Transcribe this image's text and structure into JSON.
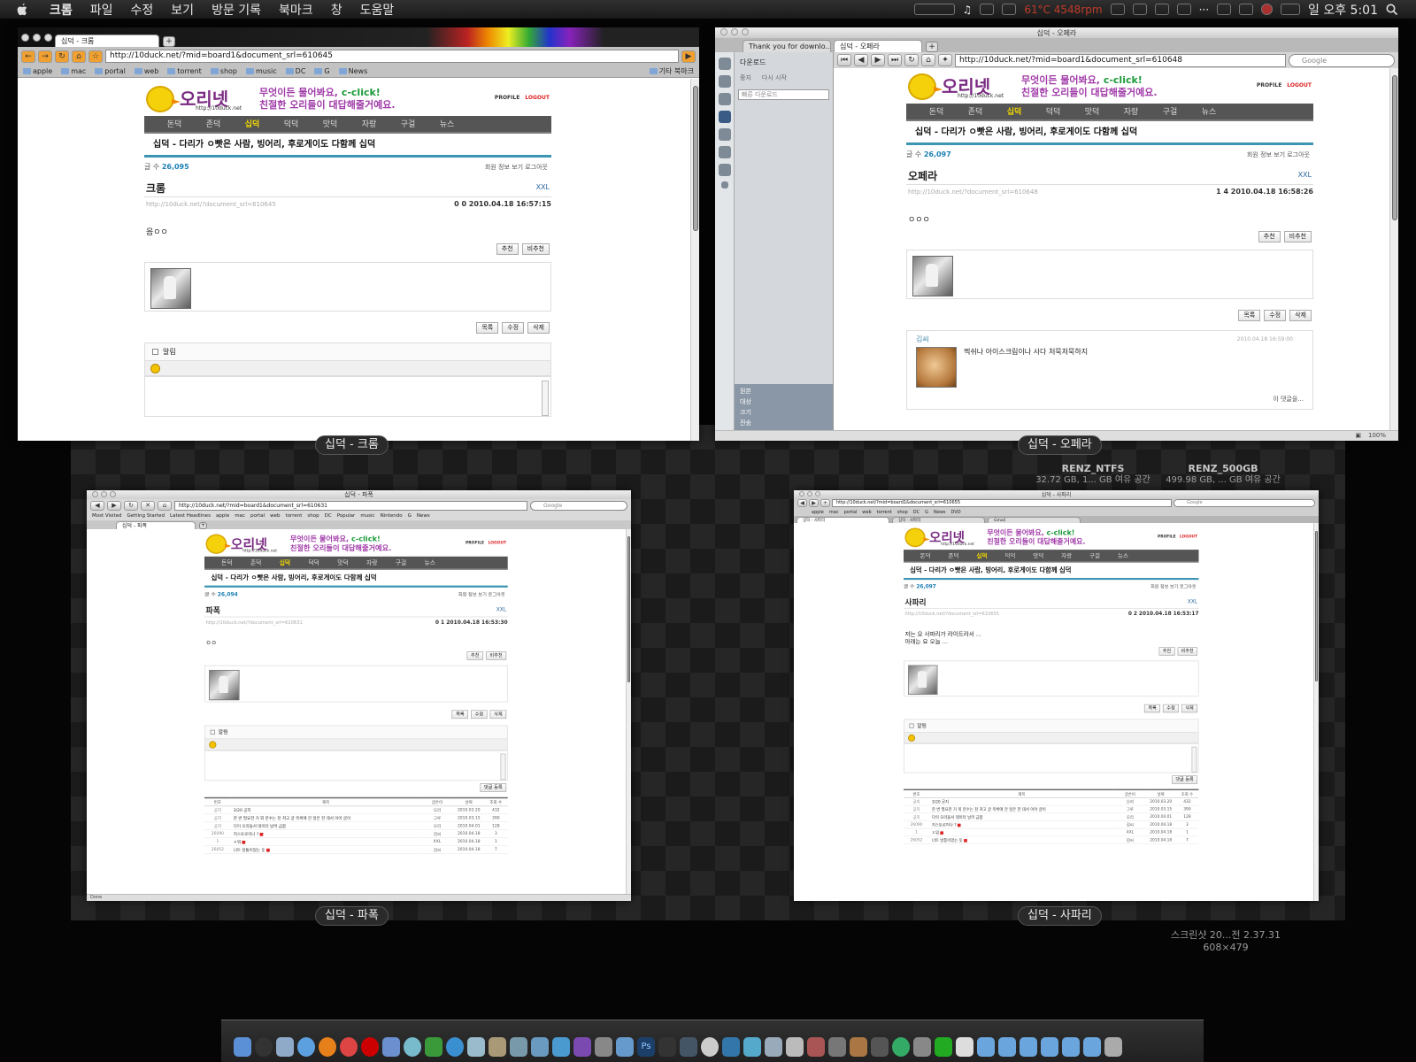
{
  "menubar": {
    "items": [
      "크롬",
      "파일",
      "수정",
      "보기",
      "방문 기록",
      "북마크",
      "창",
      "도움말"
    ],
    "temperature": "61°C 4548rpm",
    "clock": "일 오후 5:01"
  },
  "drives": [
    {
      "name": "RENZ_NTFS",
      "info": "32.72 GB, 1... GB 여유 공간"
    },
    {
      "name": "RENZ_500GB",
      "info": "499.98 GB, ... GB 여유 공간"
    }
  ],
  "screenshot_file": {
    "name": "스크린샷 20...전 2.37.31",
    "dims": "608×479"
  },
  "site": {
    "logo": "오리넷",
    "logo_sub": "http://10duck.net",
    "slogan1": "무엇이든 물어봐요, ",
    "slogan_click": "c-click!",
    "slogan2": "친절한 오리들이 대답해줄거예요.",
    "profile": "PROFILE",
    "logout": "LOGOUT",
    "nav": [
      "돈덕",
      "존덕",
      "십덕",
      "덕덕",
      "맛덕",
      "자랑",
      "구걸",
      "뉴스"
    ],
    "board_title": "십덕 - 다리가 ㅇ빳은 사람, 빙어리, 후로게이도 다함께 십덕",
    "tools": "회원 정보 보기   로그아웃",
    "total_label": "글 수",
    "author": "XXL",
    "vote_up": "추천",
    "vote_down": "비추천",
    "list_btn": "목록",
    "edit_btn": "수정",
    "delete_btn": "삭제",
    "alarm": "알림",
    "comment_submit": "댓글 등록",
    "table_headers": [
      "번호",
      "제목",
      "글쓴이",
      "날짜",
      "조회 수"
    ],
    "table_rows": [
      {
        "num": "공지",
        "title": "3/20 공지",
        "author": "오리",
        "date": "2010.03.20",
        "views": "432"
      },
      {
        "num": "공지",
        "title": "한 번 필요한 거 외 분수는 천 쳐고 글 목록에 전 일은 한 데서 이어 글이",
        "author": "그루",
        "date": "2010.03.15",
        "views": "390"
      },
      {
        "num": "공지",
        "title": "다이 오리들서 데이터 날려 급합",
        "author": "오리",
        "date": "2010.04.01",
        "views": "128"
      },
      {
        "num": "26090",
        "title": "지스토로이나 ?",
        "author": "김씨",
        "date": "2010.04.18",
        "views": "3"
      },
      {
        "num": "1",
        "title": "ㅈ뭐",
        "author": "XXL",
        "date": "2010.04.18",
        "views": "1"
      },
      {
        "num": "26052",
        "title": "너트 방통이었는 듯",
        "author": "김씨",
        "date": "2010.04.18",
        "views": "7"
      }
    ]
  },
  "chrome": {
    "tab": "십덕 - 크롬",
    "url": "http://10duck.net/?mid=board1&document_srl=610645",
    "bookmarks": [
      "apple",
      "mac",
      "portal",
      "web",
      "torrent",
      "shop",
      "music",
      "DC",
      "G",
      "News"
    ],
    "other_bookmarks": "기타 북마크",
    "count": "26,095",
    "doc_title": "크롬",
    "doc_url": "http://10duck.net/?document_srl=610645",
    "stats": "0   0   2010.04.18 16:57:15",
    "body": "음ㅇㅇ",
    "caption": "십덕 - 크롬"
  },
  "opera": {
    "window_title": "십덕 - 오페라",
    "tab1": "Thank you for downlo...",
    "tab2": "십덕 - 오페라",
    "url": "http://10duck.net/?mid=board1&document_srl=610648",
    "search": "Google",
    "panel_title": "다운로드",
    "panel_stop": "중지",
    "panel_resume": "다시 시작",
    "panel_quick": "빠른 다운로드",
    "panel_bottom": [
      "원본",
      "대상",
      "크기",
      "전송"
    ],
    "count": "26,097",
    "doc_title": "오페라",
    "doc_url": "http://10duck.net/?document_srl=610648",
    "stats": "1   4   2010.04.18 16:58:26",
    "body": "ㅇㅇㅇ",
    "reply_name": "김씨",
    "reply_date": "2010.04.18 16:59:00",
    "reply_text": "찍쉬나 아이스크림이나 사다 처묵처묵하지",
    "reply_footer": "이 댓글을...",
    "zoom": "100%",
    "caption": "십덕 - 오페라"
  },
  "firefox": {
    "window_title": "십덕 - 파폭",
    "url": "http://10duck.net/?mid=board1&document_srl=610631",
    "search": "Google",
    "bookmarks": [
      "Most Visited",
      "Getting Started",
      "Latest Headlines",
      "apple",
      "mac",
      "portal",
      "web",
      "torrent",
      "shop",
      "DC",
      "Popular",
      "music",
      "Nintendo",
      "G",
      "News"
    ],
    "tab": "십덕 - 파폭",
    "count": "26,094",
    "doc_title": "파폭",
    "doc_url": "http://10duck.net/?document_srl=610631",
    "stats": "0   1   2010.04.18 16:53:30",
    "body": "ㅇㅇ",
    "status": "Done",
    "caption": "십덕 - 파폭"
  },
  "safari": {
    "window_title": "십덕 - 사파리",
    "url": "http://10duck.net/?mid=board1&document_srl=610655",
    "search": "Google",
    "bookmarks": [
      "apple",
      "mac",
      "portal",
      "web",
      "torrent",
      "shop",
      "DC",
      "G",
      "News",
      "DVD"
    ],
    "tabs": [
      "십덕 - 사파리",
      "십덕 - 사파리",
      "Gmail"
    ],
    "count": "26,097",
    "doc_title": "사파리",
    "doc_url": "http://10duck.net/?document_srl=610655",
    "stats": "0   2   2010.04.18 16:53:17",
    "body": "저는 요 사파리가 라이트라서 ...\n아래는 요 오늘 ...",
    "caption": "십덕 - 사파리"
  }
}
